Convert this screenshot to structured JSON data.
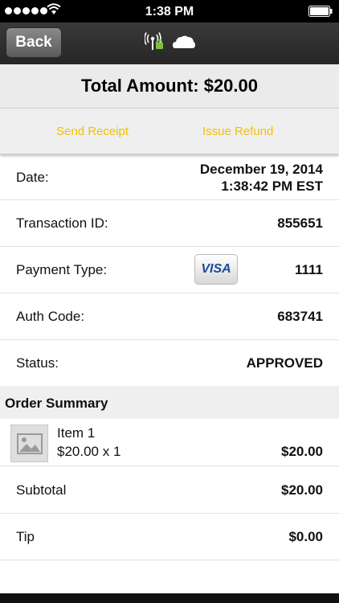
{
  "status_bar": {
    "time": "1:38 PM",
    "wifi_icon": "wifi-icon",
    "battery_icon": "battery-icon"
  },
  "navbar": {
    "back_label": "Back",
    "icons": [
      "nfc-reader-icon",
      "cloud-icon"
    ]
  },
  "header": {
    "total": "Total Amount: $20.00"
  },
  "actions": {
    "send_receipt": "Send Receipt",
    "issue_refund": "Issue Refund",
    "color": "#f2c200"
  },
  "details": {
    "date_label": "Date:",
    "date_value_line1": "December 19, 2014",
    "date_value_line2": "1:38:42 PM EST",
    "transaction_label": "Transaction ID:",
    "transaction_value": "855651",
    "payment_label": "Payment Type:",
    "payment_card_brand": "VISA",
    "payment_value": "1111",
    "auth_label": "Auth Code:",
    "auth_value": "683741",
    "status_label": "Status:",
    "status_value": "APPROVED"
  },
  "order_summary": {
    "title": "Order Summary",
    "items": [
      {
        "name": "Item 1",
        "qty_price": "$20.00 x 1",
        "total": "$20.00",
        "thumb_icon": "image-placeholder-icon"
      }
    ],
    "subtotal_label": "Subtotal",
    "subtotal_value": "$20.00",
    "tip_label": "Tip",
    "tip_value": "$0.00"
  }
}
